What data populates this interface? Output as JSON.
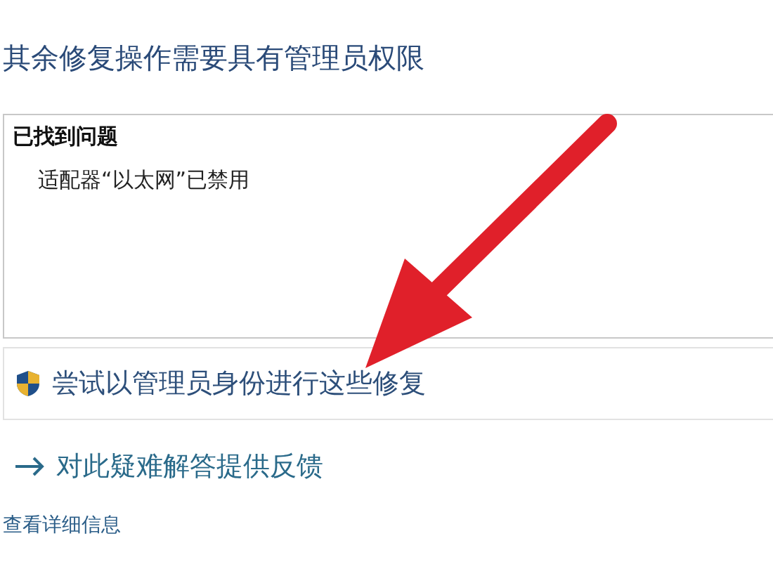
{
  "heading": "其余修复操作需要具有管理员权限",
  "problems": {
    "title": "已找到问题",
    "items": [
      "适配器“以太网”已禁用"
    ]
  },
  "admin_fix_button": {
    "label": "尝试以管理员身份进行这些修复"
  },
  "feedback_link": {
    "label": "对此疑难解答提供反馈"
  },
  "details_link": {
    "label": "查看详细信息"
  }
}
